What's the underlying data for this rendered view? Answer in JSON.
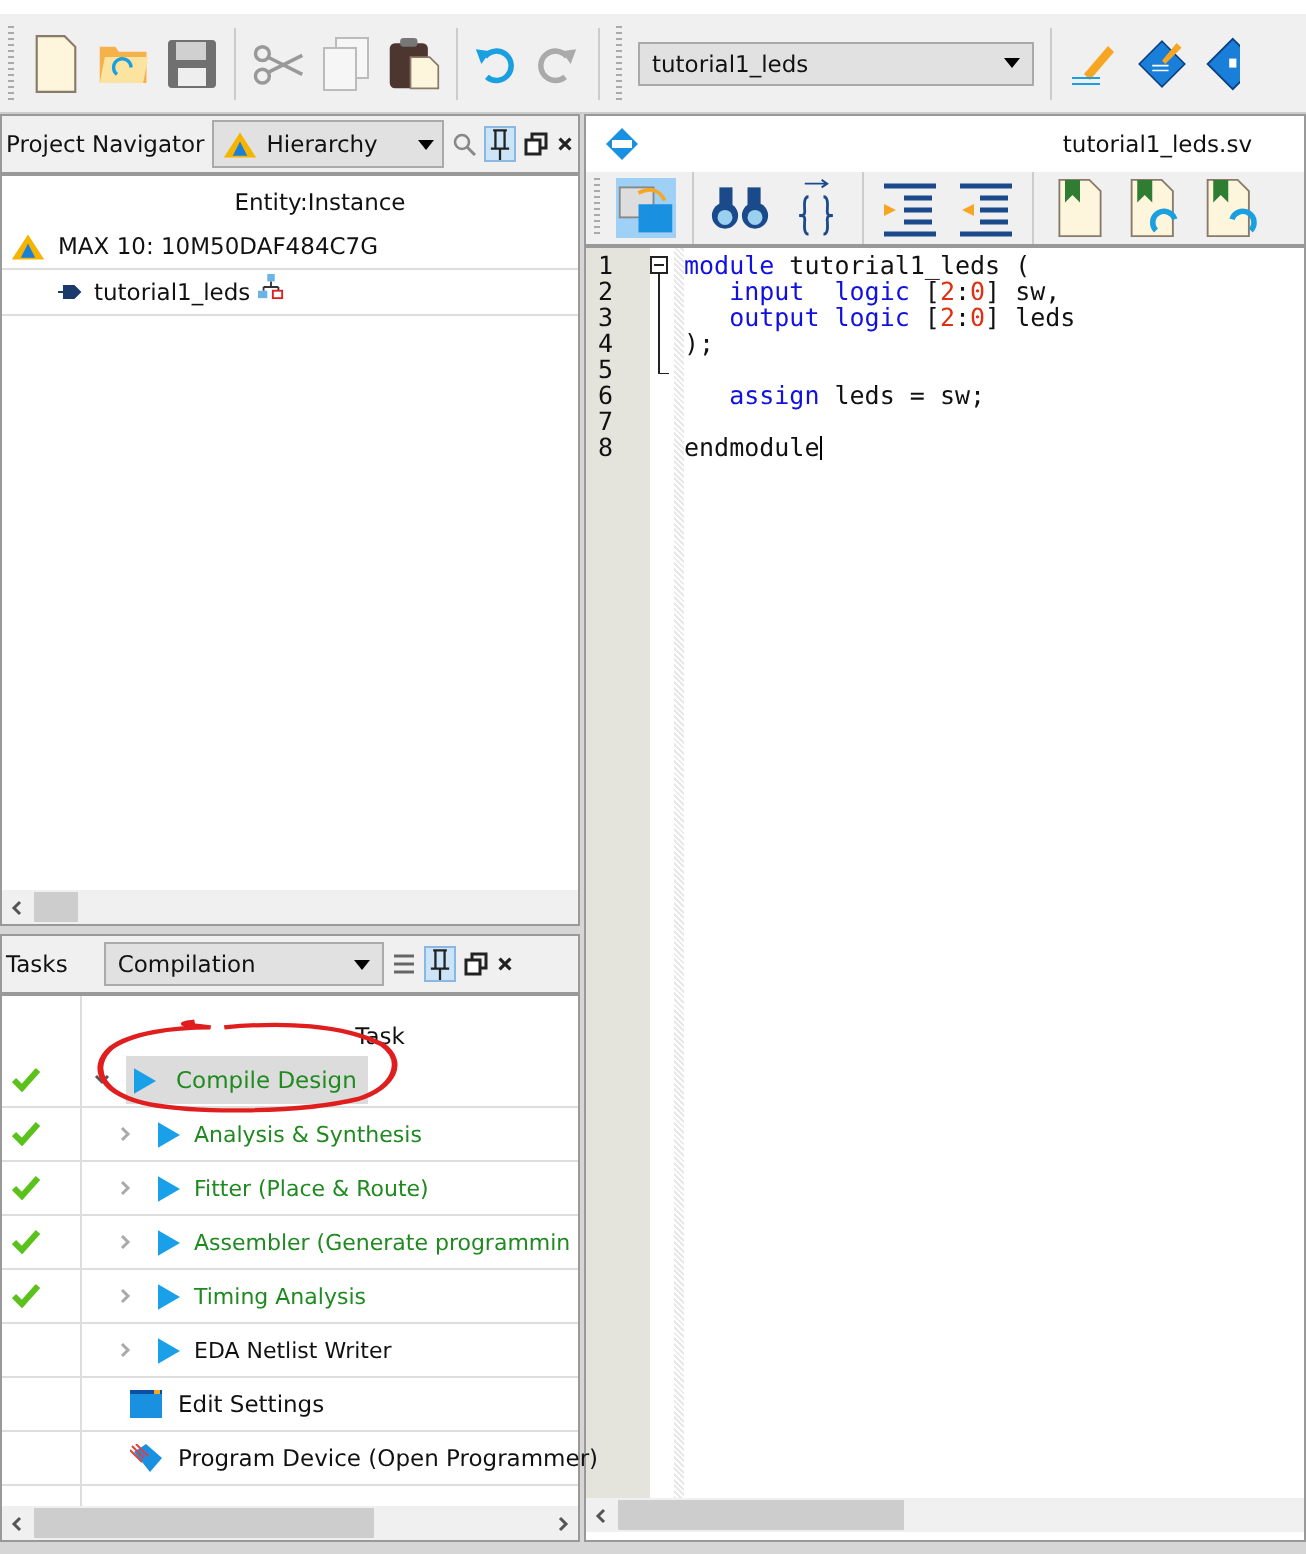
{
  "toolbar": {
    "entity": "tutorial1_leds"
  },
  "navigator": {
    "title": "Project Navigator",
    "view": "Hierarchy",
    "column": "Entity:Instance",
    "device": "MAX 10: 10M50DAF484C7G",
    "entities": [
      "tutorial1_leds"
    ]
  },
  "editor": {
    "filename": "tutorial1_leds.sv",
    "lines": [
      {
        "number": "1",
        "tokens": [
          {
            "text": "module",
            "kind": "keyword"
          },
          {
            "text": " tutorial1_leds (",
            "kind": "plain"
          }
        ]
      },
      {
        "number": "2",
        "tokens": [
          {
            "text": "   input  logic",
            "kind": "keyword"
          },
          {
            "text": " [",
            "kind": "plain"
          },
          {
            "text": "2",
            "kind": "number"
          },
          {
            "text": ":",
            "kind": "plain"
          },
          {
            "text": "0",
            "kind": "number"
          },
          {
            "text": "] sw,",
            "kind": "plain"
          }
        ]
      },
      {
        "number": "3",
        "tokens": [
          {
            "text": "   output logic",
            "kind": "keyword"
          },
          {
            "text": " [",
            "kind": "plain"
          },
          {
            "text": "2",
            "kind": "number"
          },
          {
            "text": ":",
            "kind": "plain"
          },
          {
            "text": "0",
            "kind": "number"
          },
          {
            "text": "] leds",
            "kind": "plain"
          }
        ]
      },
      {
        "number": "4",
        "tokens": [
          {
            "text": ");",
            "kind": "plain"
          }
        ]
      },
      {
        "number": "5"
      },
      {
        "number": "6",
        "tokens": [
          {
            "text": "   assign",
            "kind": "keyword"
          },
          {
            "text": " leds = sw;",
            "kind": "plain"
          }
        ]
      },
      {
        "number": "7"
      },
      {
        "number": "8",
        "tokens": [
          {
            "text": "endmodule",
            "kind": "plain"
          }
        ]
      }
    ]
  },
  "tasks": {
    "title": "Tasks",
    "flow": "Compilation",
    "column": "Task",
    "rows": [
      {
        "kind": "flow",
        "label": "Compile Design",
        "done": true,
        "selected": true,
        "expanded": true,
        "children": [
          {
            "label": "Analysis & Synthesis",
            "done": true
          },
          {
            "label": "Fitter (Place & Route)",
            "done": true
          },
          {
            "label": "Assembler (Generate programmin",
            "done": true
          },
          {
            "label": "Timing Analysis",
            "done": true
          },
          {
            "label": "EDA Netlist Writer",
            "done": false
          }
        ]
      },
      {
        "kind": "settings",
        "label": "Edit Settings",
        "done": false,
        "selected": false
      },
      {
        "kind": "program",
        "label": "Program Device (Open Programmer)",
        "done": false,
        "selected": false
      }
    ]
  }
}
